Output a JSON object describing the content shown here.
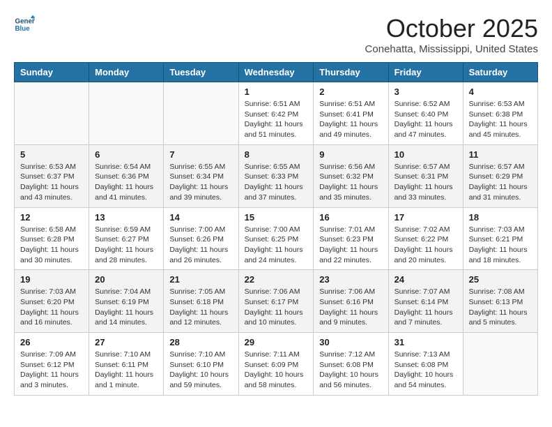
{
  "header": {
    "logo_line1": "General",
    "logo_line2": "Blue",
    "month": "October 2025",
    "location": "Conehatta, Mississippi, United States"
  },
  "weekdays": [
    "Sunday",
    "Monday",
    "Tuesday",
    "Wednesday",
    "Thursday",
    "Friday",
    "Saturday"
  ],
  "weeks": [
    [
      {
        "day": "",
        "sunrise": "",
        "sunset": "",
        "daylight": ""
      },
      {
        "day": "",
        "sunrise": "",
        "sunset": "",
        "daylight": ""
      },
      {
        "day": "",
        "sunrise": "",
        "sunset": "",
        "daylight": ""
      },
      {
        "day": "1",
        "sunrise": "Sunrise: 6:51 AM",
        "sunset": "Sunset: 6:42 PM",
        "daylight": "Daylight: 11 hours and 51 minutes."
      },
      {
        "day": "2",
        "sunrise": "Sunrise: 6:51 AM",
        "sunset": "Sunset: 6:41 PM",
        "daylight": "Daylight: 11 hours and 49 minutes."
      },
      {
        "day": "3",
        "sunrise": "Sunrise: 6:52 AM",
        "sunset": "Sunset: 6:40 PM",
        "daylight": "Daylight: 11 hours and 47 minutes."
      },
      {
        "day": "4",
        "sunrise": "Sunrise: 6:53 AM",
        "sunset": "Sunset: 6:38 PM",
        "daylight": "Daylight: 11 hours and 45 minutes."
      }
    ],
    [
      {
        "day": "5",
        "sunrise": "Sunrise: 6:53 AM",
        "sunset": "Sunset: 6:37 PM",
        "daylight": "Daylight: 11 hours and 43 minutes."
      },
      {
        "day": "6",
        "sunrise": "Sunrise: 6:54 AM",
        "sunset": "Sunset: 6:36 PM",
        "daylight": "Daylight: 11 hours and 41 minutes."
      },
      {
        "day": "7",
        "sunrise": "Sunrise: 6:55 AM",
        "sunset": "Sunset: 6:34 PM",
        "daylight": "Daylight: 11 hours and 39 minutes."
      },
      {
        "day": "8",
        "sunrise": "Sunrise: 6:55 AM",
        "sunset": "Sunset: 6:33 PM",
        "daylight": "Daylight: 11 hours and 37 minutes."
      },
      {
        "day": "9",
        "sunrise": "Sunrise: 6:56 AM",
        "sunset": "Sunset: 6:32 PM",
        "daylight": "Daylight: 11 hours and 35 minutes."
      },
      {
        "day": "10",
        "sunrise": "Sunrise: 6:57 AM",
        "sunset": "Sunset: 6:31 PM",
        "daylight": "Daylight: 11 hours and 33 minutes."
      },
      {
        "day": "11",
        "sunrise": "Sunrise: 6:57 AM",
        "sunset": "Sunset: 6:29 PM",
        "daylight": "Daylight: 11 hours and 31 minutes."
      }
    ],
    [
      {
        "day": "12",
        "sunrise": "Sunrise: 6:58 AM",
        "sunset": "Sunset: 6:28 PM",
        "daylight": "Daylight: 11 hours and 30 minutes."
      },
      {
        "day": "13",
        "sunrise": "Sunrise: 6:59 AM",
        "sunset": "Sunset: 6:27 PM",
        "daylight": "Daylight: 11 hours and 28 minutes."
      },
      {
        "day": "14",
        "sunrise": "Sunrise: 7:00 AM",
        "sunset": "Sunset: 6:26 PM",
        "daylight": "Daylight: 11 hours and 26 minutes."
      },
      {
        "day": "15",
        "sunrise": "Sunrise: 7:00 AM",
        "sunset": "Sunset: 6:25 PM",
        "daylight": "Daylight: 11 hours and 24 minutes."
      },
      {
        "day": "16",
        "sunrise": "Sunrise: 7:01 AM",
        "sunset": "Sunset: 6:23 PM",
        "daylight": "Daylight: 11 hours and 22 minutes."
      },
      {
        "day": "17",
        "sunrise": "Sunrise: 7:02 AM",
        "sunset": "Sunset: 6:22 PM",
        "daylight": "Daylight: 11 hours and 20 minutes."
      },
      {
        "day": "18",
        "sunrise": "Sunrise: 7:03 AM",
        "sunset": "Sunset: 6:21 PM",
        "daylight": "Daylight: 11 hours and 18 minutes."
      }
    ],
    [
      {
        "day": "19",
        "sunrise": "Sunrise: 7:03 AM",
        "sunset": "Sunset: 6:20 PM",
        "daylight": "Daylight: 11 hours and 16 minutes."
      },
      {
        "day": "20",
        "sunrise": "Sunrise: 7:04 AM",
        "sunset": "Sunset: 6:19 PM",
        "daylight": "Daylight: 11 hours and 14 minutes."
      },
      {
        "day": "21",
        "sunrise": "Sunrise: 7:05 AM",
        "sunset": "Sunset: 6:18 PM",
        "daylight": "Daylight: 11 hours and 12 minutes."
      },
      {
        "day": "22",
        "sunrise": "Sunrise: 7:06 AM",
        "sunset": "Sunset: 6:17 PM",
        "daylight": "Daylight: 11 hours and 10 minutes."
      },
      {
        "day": "23",
        "sunrise": "Sunrise: 7:06 AM",
        "sunset": "Sunset: 6:16 PM",
        "daylight": "Daylight: 11 hours and 9 minutes."
      },
      {
        "day": "24",
        "sunrise": "Sunrise: 7:07 AM",
        "sunset": "Sunset: 6:14 PM",
        "daylight": "Daylight: 11 hours and 7 minutes."
      },
      {
        "day": "25",
        "sunrise": "Sunrise: 7:08 AM",
        "sunset": "Sunset: 6:13 PM",
        "daylight": "Daylight: 11 hours and 5 minutes."
      }
    ],
    [
      {
        "day": "26",
        "sunrise": "Sunrise: 7:09 AM",
        "sunset": "Sunset: 6:12 PM",
        "daylight": "Daylight: 11 hours and 3 minutes."
      },
      {
        "day": "27",
        "sunrise": "Sunrise: 7:10 AM",
        "sunset": "Sunset: 6:11 PM",
        "daylight": "Daylight: 11 hours and 1 minute."
      },
      {
        "day": "28",
        "sunrise": "Sunrise: 7:10 AM",
        "sunset": "Sunset: 6:10 PM",
        "daylight": "Daylight: 10 hours and 59 minutes."
      },
      {
        "day": "29",
        "sunrise": "Sunrise: 7:11 AM",
        "sunset": "Sunset: 6:09 PM",
        "daylight": "Daylight: 10 hours and 58 minutes."
      },
      {
        "day": "30",
        "sunrise": "Sunrise: 7:12 AM",
        "sunset": "Sunset: 6:08 PM",
        "daylight": "Daylight: 10 hours and 56 minutes."
      },
      {
        "day": "31",
        "sunrise": "Sunrise: 7:13 AM",
        "sunset": "Sunset: 6:08 PM",
        "daylight": "Daylight: 10 hours and 54 minutes."
      },
      {
        "day": "",
        "sunrise": "",
        "sunset": "",
        "daylight": ""
      }
    ]
  ]
}
